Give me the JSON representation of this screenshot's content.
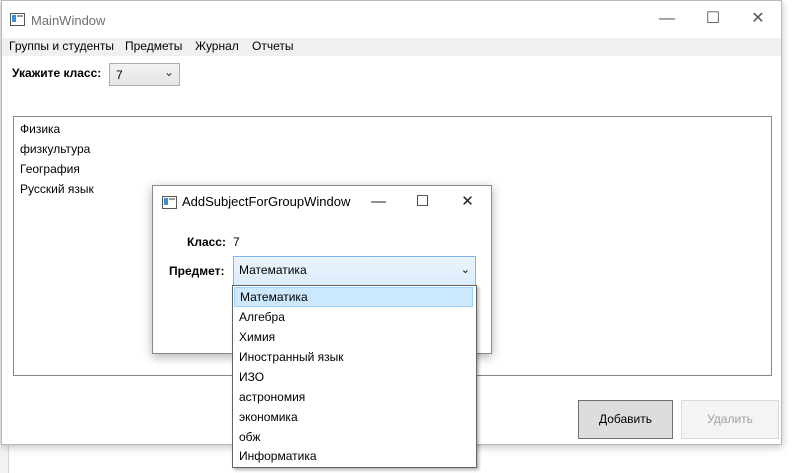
{
  "main_window": {
    "title": "MainWindow",
    "controls": {
      "minimize": "—",
      "maximize": "☐",
      "close": "✕"
    },
    "menu": [
      "Группы и студенты",
      "Предметы",
      "Журнал",
      "Отчеты"
    ],
    "class_label": "Укажите класс:",
    "class_value": "7",
    "subjects": [
      "Физика",
      "физкультура",
      "География",
      "Русский язык"
    ],
    "buttons": {
      "add": "Добавить",
      "delete": "Удалить"
    }
  },
  "dialog": {
    "title": "AddSubjectForGroupWindow",
    "controls": {
      "minimize": "—",
      "maximize": "☐",
      "close": "✕"
    },
    "class_label": "Класс:",
    "class_value": "7",
    "subject_label": "Предмет:",
    "subject_value": "Математика",
    "options": [
      "Математика",
      "Алгебра",
      "Химия",
      "Иностранный язык",
      "ИЗО",
      "астрономия",
      "экономика",
      "обж",
      "Информатика"
    ]
  },
  "colors": {
    "selection": "#cce8ff",
    "combo_focus": "#7eb4ea"
  },
  "icons": {
    "dropdown": "chevron-down-icon",
    "window": "window-icon"
  }
}
